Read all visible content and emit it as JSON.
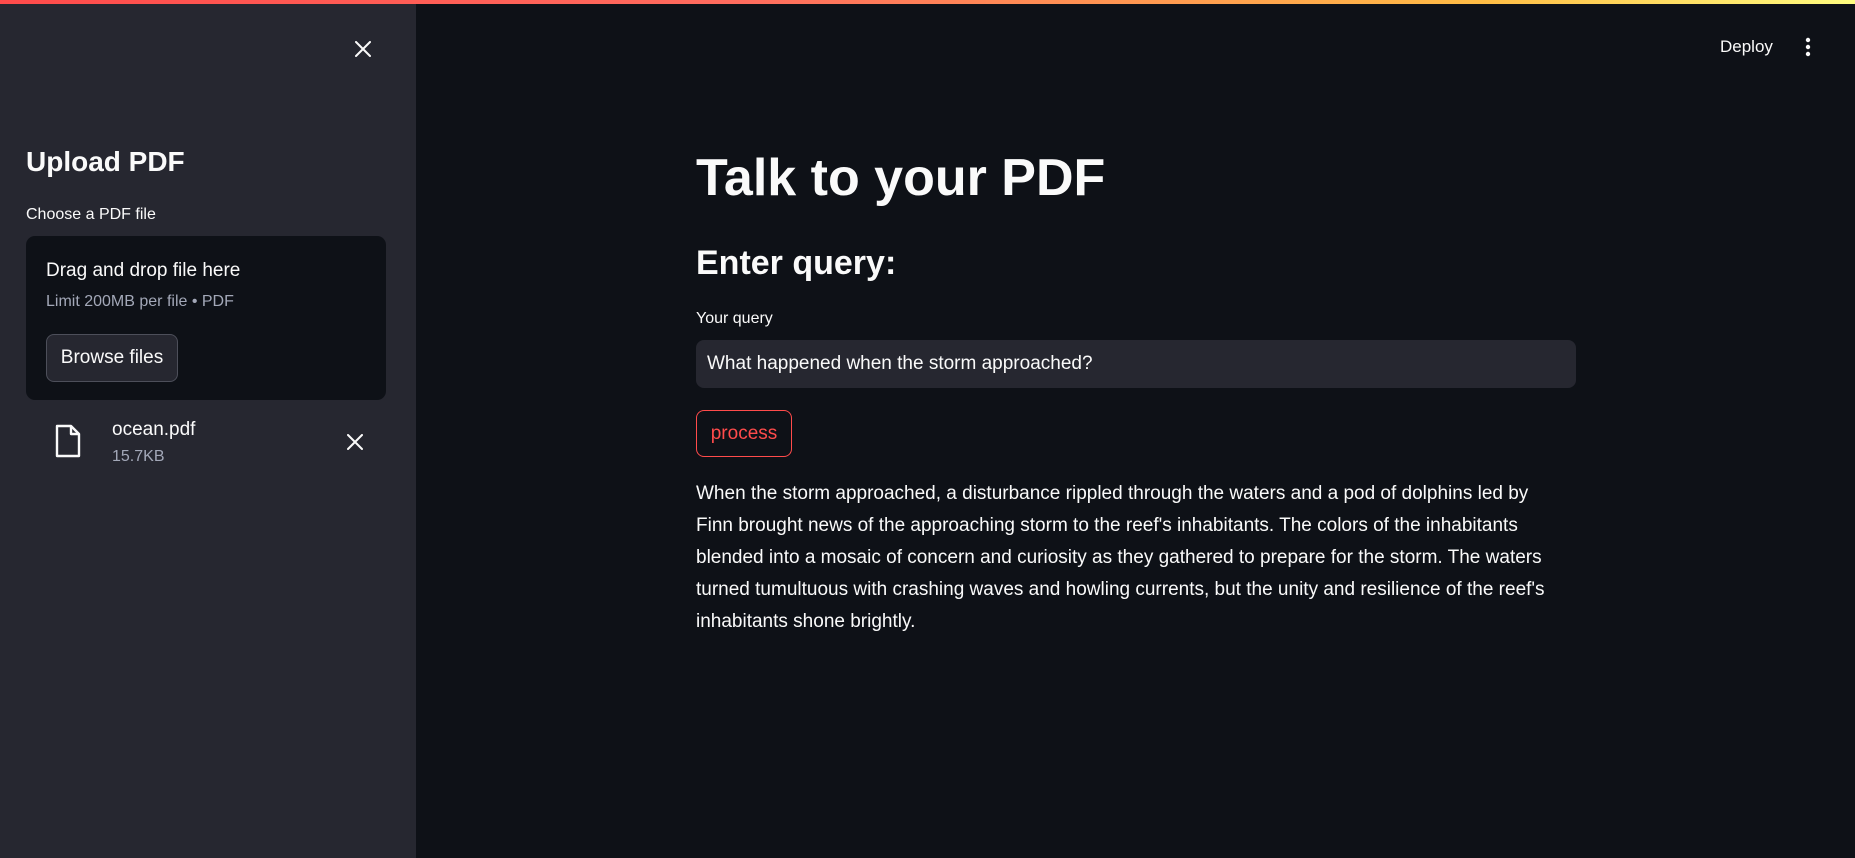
{
  "colors": {
    "background": "#0e1117",
    "sidebar": "#262730",
    "accent": "#ff4b4b",
    "text": "#fafafa",
    "muted": "#a3a8b8"
  },
  "sidebar": {
    "title": "Upload PDF",
    "close_icon": "close-icon",
    "uploader": {
      "label": "Choose a PDF file",
      "dropzone_title": "Drag and drop file here",
      "limit_text": "Limit 200MB per file • PDF",
      "browse_label": "Browse files"
    },
    "uploaded_file": {
      "icon": "file-icon",
      "name": "ocean.pdf",
      "size": "15.7KB",
      "remove_icon": "close-icon"
    }
  },
  "header": {
    "deploy_label": "Deploy",
    "menu_icon": "kebab-menu-icon"
  },
  "main": {
    "title": "Talk to your PDF",
    "section_title": "Enter query:",
    "query": {
      "label": "Your query",
      "value": "What happened when the storm approached?"
    },
    "process_label": "process",
    "answer": "When the storm approached, a disturbance rippled through the waters and a pod of dolphins led by Finn brought news of the approaching storm to the reef's inhabitants. The colors of the inhabitants blended into a mosaic of concern and curiosity as they gathered to prepare for the storm. The waters turned tumultuous with crashing waves and howling currents, but the unity and resilience of the reef's inhabitants shone brightly."
  }
}
